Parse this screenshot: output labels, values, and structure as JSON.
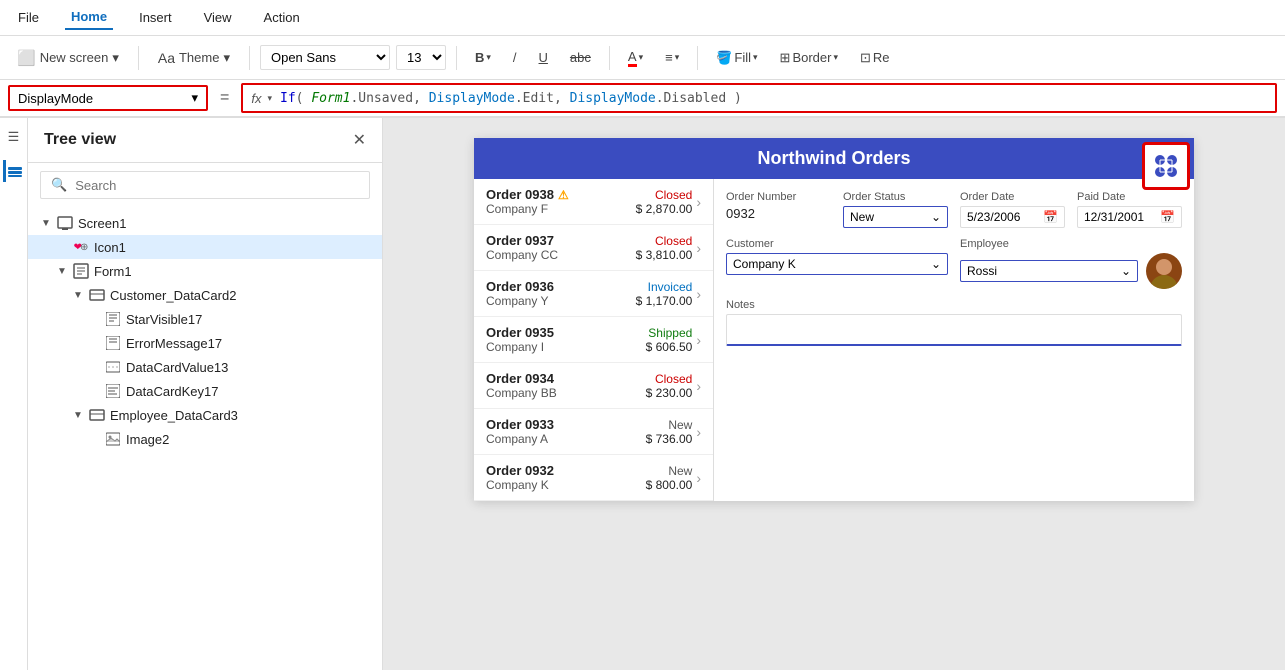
{
  "menubar": {
    "items": [
      {
        "label": "File",
        "active": false
      },
      {
        "label": "Home",
        "active": true
      },
      {
        "label": "Insert",
        "active": false
      },
      {
        "label": "View",
        "active": false
      },
      {
        "label": "Action",
        "active": false
      }
    ]
  },
  "toolbar": {
    "new_screen_label": "New screen",
    "theme_label": "Theme",
    "font_value": "Open Sans",
    "font_size_value": "13",
    "bold_label": "B",
    "italic_label": "/",
    "underline_label": "U",
    "strikethrough_label": "abc",
    "font_color_label": "A",
    "align_label": "≡",
    "fill_label": "Fill",
    "border_label": "Border",
    "re_label": "Re"
  },
  "formula_bar": {
    "name_box": "DisplayMode",
    "fx_label": "fx",
    "formula": "If( Form1.Unsaved, DisplayMode.Edit, DisplayMode.Disabled )"
  },
  "tree_panel": {
    "title": "Tree view",
    "search_placeholder": "Search",
    "items": [
      {
        "id": "screen1",
        "label": "Screen1",
        "level": 0,
        "expanded": true,
        "type": "screen"
      },
      {
        "id": "icon1",
        "label": "Icon1",
        "level": 1,
        "expanded": false,
        "type": "icon"
      },
      {
        "id": "form1",
        "label": "Form1",
        "level": 1,
        "expanded": true,
        "type": "form"
      },
      {
        "id": "customer_datacard2",
        "label": "Customer_DataCard2",
        "level": 2,
        "expanded": true,
        "type": "datacard"
      },
      {
        "id": "starvisible17",
        "label": "StarVisible17",
        "level": 3,
        "expanded": false,
        "type": "star"
      },
      {
        "id": "errormessage17",
        "label": "ErrorMessage17",
        "level": 3,
        "expanded": false,
        "type": "error"
      },
      {
        "id": "datacardvalue13",
        "label": "DataCardValue13",
        "level": 3,
        "expanded": false,
        "type": "input"
      },
      {
        "id": "datacardkey17",
        "label": "DataCardKey17",
        "level": 3,
        "expanded": false,
        "type": "label"
      },
      {
        "id": "employee_datacard3",
        "label": "Employee_DataCard3",
        "level": 2,
        "expanded": true,
        "type": "datacard"
      },
      {
        "id": "image2",
        "label": "Image2",
        "level": 3,
        "expanded": false,
        "type": "image"
      }
    ]
  },
  "app": {
    "title": "Northwind Orders",
    "orders": [
      {
        "num": "Order 0938",
        "company": "Company F",
        "amount": "$ 2,870.00",
        "status": "Closed",
        "status_type": "closed",
        "warn": true
      },
      {
        "num": "Order 0937",
        "company": "Company CC",
        "amount": "$ 3,810.00",
        "status": "Closed",
        "status_type": "closed",
        "warn": false
      },
      {
        "num": "Order 0936",
        "company": "Company Y",
        "amount": "$ 1,170.00",
        "status": "Invoiced",
        "status_type": "invoiced",
        "warn": false
      },
      {
        "num": "Order 0935",
        "company": "Company I",
        "amount": "$ 606.50",
        "status": "Shipped",
        "status_type": "shipped",
        "warn": false
      },
      {
        "num": "Order 0934",
        "company": "Company BB",
        "amount": "$ 230.00",
        "status": "Closed",
        "status_type": "closed",
        "warn": false
      },
      {
        "num": "Order 0933",
        "company": "Company A",
        "amount": "$ 736.00",
        "status": "New",
        "status_type": "new",
        "warn": false
      },
      {
        "num": "Order 0932",
        "company": "Company K",
        "amount": "$ 800.00",
        "status": "New",
        "status_type": "new",
        "warn": false
      }
    ],
    "detail": {
      "order_number_label": "Order Number",
      "order_number_value": "0932",
      "order_status_label": "Order Status",
      "order_status_value": "New",
      "order_date_label": "Order Date",
      "order_date_value": "5/23/2006",
      "paid_date_label": "Paid Date",
      "paid_date_value": "12/31/2001",
      "customer_label": "Customer",
      "customer_value": "Company K",
      "employee_label": "Employee",
      "employee_value": "Rossi",
      "notes_label": "Notes",
      "notes_value": ""
    }
  }
}
